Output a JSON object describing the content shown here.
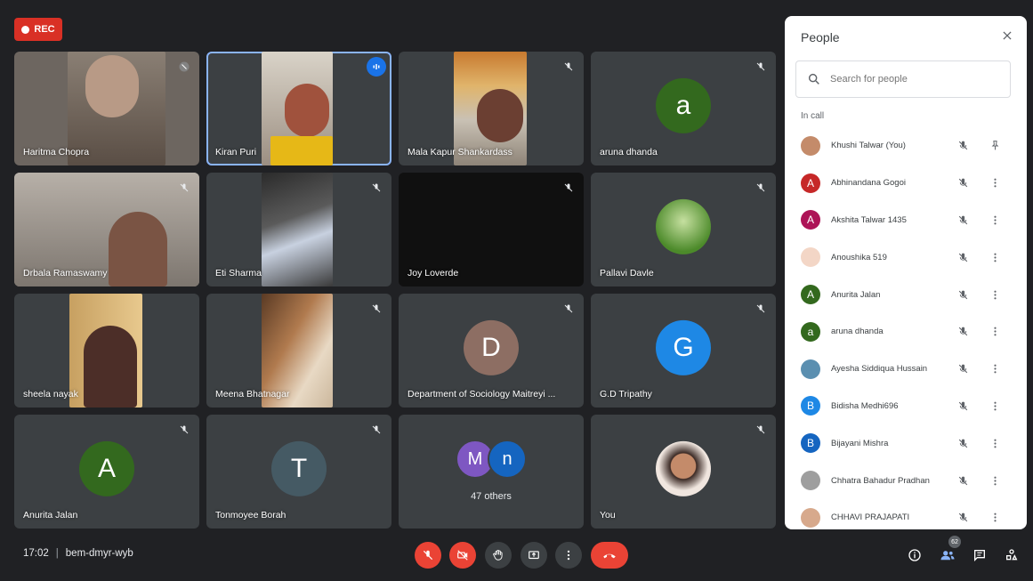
{
  "recording": {
    "label": "REC"
  },
  "tiles": [
    {
      "name": "Haritma Chopra"
    },
    {
      "name": "Kiran Puri"
    },
    {
      "name": "Mala Kapur Shankardass"
    },
    {
      "name": "aruna dhanda",
      "initial": "a",
      "color": "#33691e"
    },
    {
      "name": "Drbala Ramaswamy"
    },
    {
      "name": "Eti Sharma"
    },
    {
      "name": "Joy Loverde"
    },
    {
      "name": "Pallavi Davle"
    },
    {
      "name": "sheela nayak"
    },
    {
      "name": "Meena Bhatnagar"
    },
    {
      "name": "Department of Sociology Maitreyi ...",
      "initial": "D",
      "color": "#8d6e63"
    },
    {
      "name": "G.D Tripathy",
      "initial": "G",
      "color": "#1e88e5"
    },
    {
      "name": "Anurita Jalan",
      "initial": "A",
      "color": "#33691e"
    },
    {
      "name": "Tonmoyee Borah",
      "initial": "T",
      "color": "#455a64"
    },
    {
      "others": "47 others",
      "initial1": "M",
      "initial2": "n",
      "color1": "#7e57c2",
      "color2": "#1565c0"
    },
    {
      "name": "You"
    }
  ],
  "panel": {
    "title": "People",
    "search_placeholder": "Search for people",
    "section": "In call",
    "people": [
      {
        "name": "Khushi Talwar (You)",
        "initial": "",
        "color": "#c48b6a"
      },
      {
        "name": "Abhinandana Gogoi",
        "initial": "A",
        "color": "#c62828"
      },
      {
        "name": "Akshita Talwar 1435",
        "initial": "A",
        "color": "#ad1457"
      },
      {
        "name": "Anoushika 519",
        "initial": "",
        "color": "#f3d6c6"
      },
      {
        "name": "Anurita Jalan",
        "initial": "A",
        "color": "#33691e"
      },
      {
        "name": "aruna dhanda",
        "initial": "a",
        "color": "#33691e"
      },
      {
        "name": "Ayesha Siddiqua Hussain",
        "initial": "",
        "color": "#5b8fb0"
      },
      {
        "name": "Bidisha Medhi696",
        "initial": "B",
        "color": "#1e88e5"
      },
      {
        "name": "Bijayani Mishra",
        "initial": "B",
        "color": "#1565c0"
      },
      {
        "name": "Chhatra Bahadur Pradhan",
        "initial": "",
        "color": "#9e9e9e"
      },
      {
        "name": "CHHAVI PRAJAPATI",
        "initial": "",
        "color": "#d7a98c"
      }
    ]
  },
  "footer": {
    "time": "17:02",
    "meeting_code": "bem-dmyr-wyb",
    "participant_count": "62"
  },
  "colors": {
    "accent": "#1a73e8",
    "danger": "#ea4335",
    "tile_bg": "#3c4043",
    "page_bg": "#202124"
  }
}
